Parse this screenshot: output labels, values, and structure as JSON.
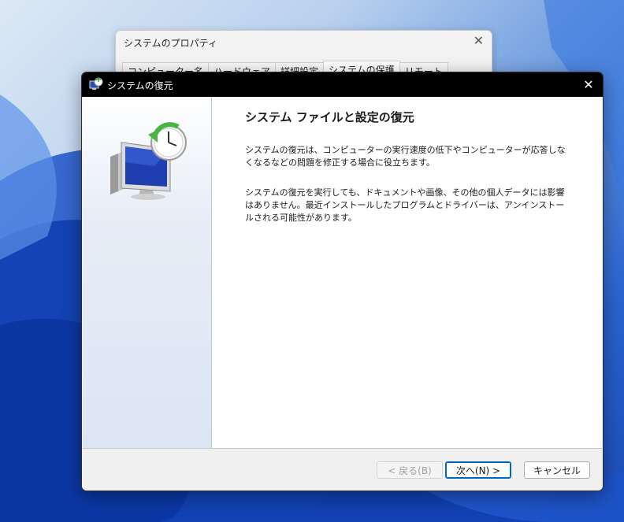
{
  "background_window": {
    "title": "システムのプロパティ",
    "close": "✕",
    "tabs": [
      "コンピューター名",
      "ハードウェア",
      "詳細設定",
      "システムの保護",
      "リモート"
    ],
    "active_tab": "システムの保護"
  },
  "dialog": {
    "title": "システムの復元",
    "close": "✕",
    "heading": "システム ファイルと設定の復元",
    "paragraph1": "システムの復元は、コンピューターの実行速度の低下やコンピューターが応答しなくなるなどの問題を修正する場合に役立ちます。",
    "paragraph2": "システムの復元を実行しても、ドキュメントや画像、その他の個人データには影響はありません。最近インストールしたプログラムとドライバーは、アンインストールされる可能性があります。",
    "buttons": {
      "back": "< 戻る(B)",
      "next": "次へ(N) >",
      "cancel": "キャンセル"
    }
  },
  "colors": {
    "titlebar": "#000000",
    "accent_focus": "#0067c0",
    "left_pane": "#dbe5f3"
  },
  "icons": [
    "system-restore-icon",
    "close-icon",
    "monitor-clock-illustration"
  ]
}
